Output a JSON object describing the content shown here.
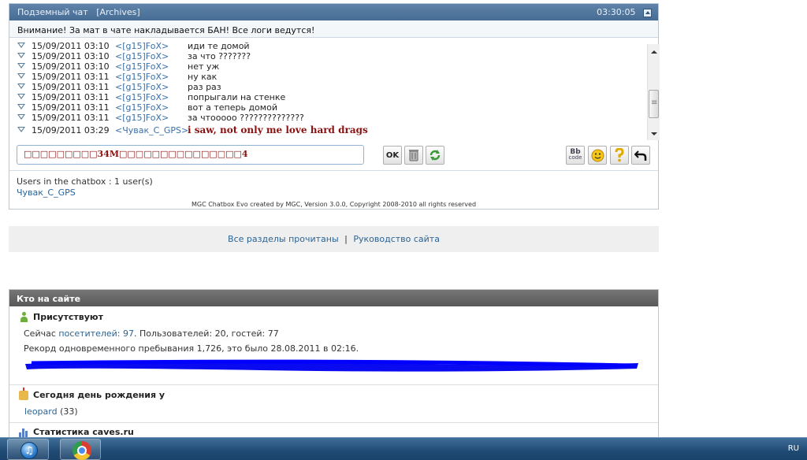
{
  "chatbox": {
    "title": "Подземный чат",
    "archives_label": "[Archives]",
    "time": "03:30:05",
    "notice": "Внимание! За мат в чате накладывается БАН! Все логи ведутся!",
    "messages": [
      {
        "date": "15/09/2011 03:10",
        "nick": "<[g15]FoX>",
        "text": "иди те домой"
      },
      {
        "date": "15/09/2011 03:10",
        "nick": "<[g15]FoX>",
        "text": "за что ???????"
      },
      {
        "date": "15/09/2011 03:10",
        "nick": "<[g15]FoX>",
        "text": "нет уж"
      },
      {
        "date": "15/09/2011 03:11",
        "nick": "<[g15]FoX>",
        "text": "ну как"
      },
      {
        "date": "15/09/2011 03:11",
        "nick": "<[g15]FoX>",
        "text": "раз раз"
      },
      {
        "date": "15/09/2011 03:11",
        "nick": "<[g15]FoX>",
        "text": "попрыгали на стенке"
      },
      {
        "date": "15/09/2011 03:11",
        "nick": "<[g15]FoX>",
        "text": "вот а теперь домой"
      },
      {
        "date": "15/09/2011 03:11",
        "nick": "<[g15]FoX>",
        "text": "за чтооооо ??????????????"
      },
      {
        "date": "15/09/2011 03:29",
        "nick": "<Чувак_С_GPS>",
        "text": "i saw, not only me love hard drags"
      }
    ],
    "input_value": "□□□□□□□□□34M□□□□□□□□□□□□□□□4",
    "ok_label": "OK",
    "bbcode_label_top": "Bb",
    "bbcode_label_bottom": "code",
    "users_line": "Users in the chatbox : 1 user(s)",
    "user_name": "Чувак_С_GPS",
    "credit": "MGC Chatbox Evo created by MGC, Version 3.0.0, Copyright 2008-2010 all rights reserved"
  },
  "nav": {
    "mark_read": "Все разделы прочитаны",
    "separator": "|",
    "site_guide": "Руководство сайта"
  },
  "who_online": {
    "header": "Кто на сайте",
    "present_title": "Присутствуют",
    "now_prefix": "Сейчас",
    "visitors_link": "посетителей: 97",
    "now_rest": ". Пользователей: 20, гостей: 77",
    "record": "Рекорд одновременного пребывания 1,726, это было 28.08.2011 в 02:16.",
    "birthday_title": "Сегодня день рождения у",
    "birthday_user": "leopard",
    "birthday_age": " (33)",
    "stats_title": "Статистика caves.ru"
  },
  "taskbar": {
    "itunes_glyph": "♫",
    "language": "RU"
  },
  "colors": {
    "chat_header": "#4f74a0",
    "link": "#2a6496",
    "highlight_text": "#8b1010",
    "who_header": "#636363",
    "scribble": "#0000ff",
    "taskbar": "#1f4a74"
  },
  "icons": {
    "arrow_icon": "message-arrow-icon",
    "ok_icon": "ok-icon",
    "trash_icon": "trash-icon",
    "refresh_icon": "refresh-icon",
    "bbcode_icon": "bbcode-icon",
    "smiley_icon": "smiley-icon",
    "help_icon": "question-icon",
    "undo_icon": "undo-arrow-icon"
  }
}
